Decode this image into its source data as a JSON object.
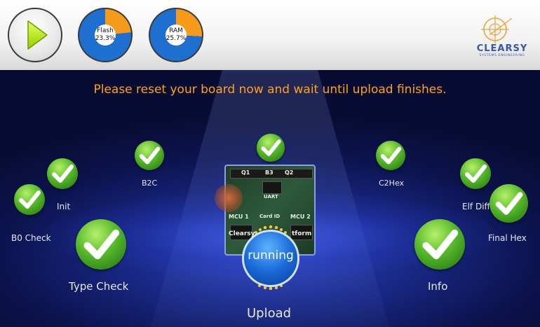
{
  "toolbar": {
    "play_icon": "play-icon",
    "flash": {
      "label": "Flash",
      "value": "23.3%",
      "fill": 0.233
    },
    "ram": {
      "label": "RAM",
      "value": "25.7%",
      "fill": 0.257
    },
    "logo": {
      "name": "CLEARSY",
      "subtitle": "SYSTEMS ENGINEERING"
    }
  },
  "stage": {
    "message": "Please reset your board now and wait until upload finishes.",
    "steps": {
      "b0_check": "B0 Check",
      "init": "Init",
      "b2c": "B2C",
      "c2hex": "C2Hex",
      "elf_diff": "Elf Diff",
      "final_hex": "Final Hex",
      "type_check": "Type Check",
      "info": "Info",
      "upload": "Upload"
    },
    "run_button": "running",
    "board": {
      "labels": [
        "Q1",
        "B3",
        "Q2",
        "UART",
        "MCU 1",
        "Card ID",
        "MCU 2",
        "Clearsy",
        "tform"
      ]
    }
  },
  "colors": {
    "accent_orange": "#ffa020",
    "gauge_orange": "#f59a1b",
    "gauge_blue": "#1e6fd0",
    "check_green": "#56b82a",
    "run_blue": "#1a6ad8"
  }
}
